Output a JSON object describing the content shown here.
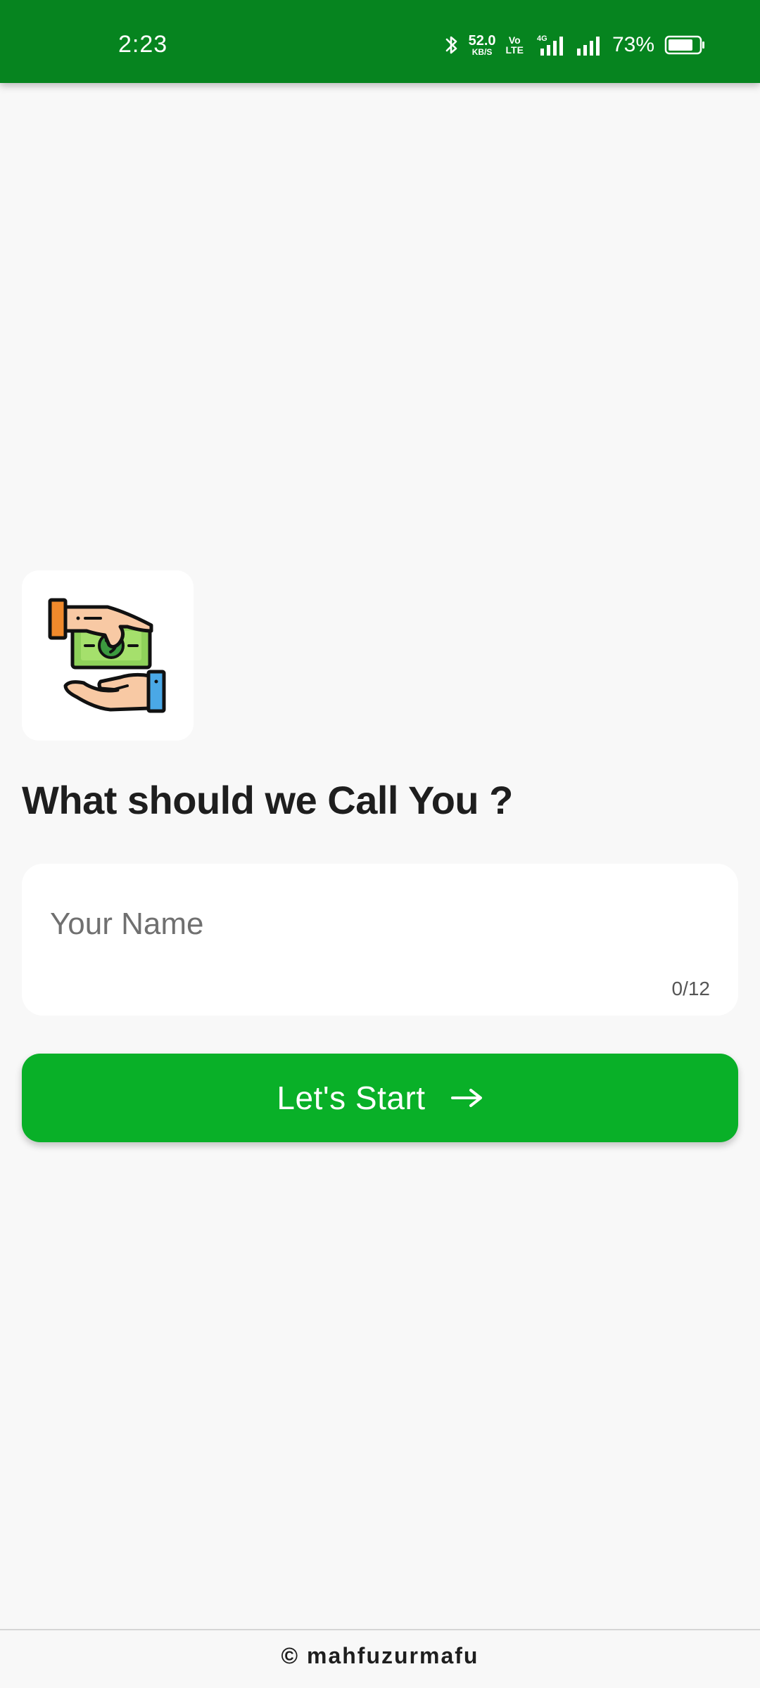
{
  "status_bar": {
    "time": "2:23",
    "net_speed_value": "52.0",
    "net_speed_unit": "KB/S",
    "volte_top": "Vo",
    "volte_bottom": "LTE",
    "network_type": "4G",
    "battery_percent": "73%",
    "icons": [
      "bluetooth-icon",
      "signal-4g-icon",
      "signal-icon",
      "battery-icon"
    ]
  },
  "illustration": {
    "icon": "money-exchange-hands-icon"
  },
  "main": {
    "heading": "What should we Call You ?",
    "name_field": {
      "placeholder": "Your Name",
      "value": "",
      "counter": "0/12"
    },
    "start_button": {
      "label": "Let's Start",
      "icon": "arrow-right-icon"
    }
  },
  "footer": {
    "text": "© mahfuzurmafu"
  },
  "colors": {
    "status_bar": "#06841f",
    "button": "#09b028",
    "background": "#f8f8f8",
    "card": "#ffffff",
    "heading": "#1e1e1e"
  }
}
